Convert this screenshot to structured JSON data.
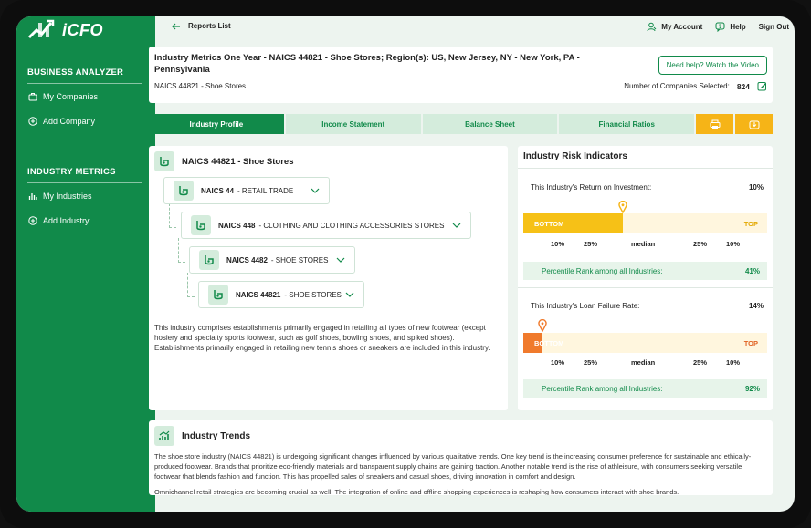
{
  "brand": {
    "name": "iCFO"
  },
  "sidebar": {
    "sections": [
      {
        "title": "BUSINESS ANALYZER",
        "items": [
          {
            "label": "My Companies"
          },
          {
            "label": "Add Company"
          }
        ]
      },
      {
        "title": "INDUSTRY METRICS",
        "items": [
          {
            "label": "My Industries"
          },
          {
            "label": "Add Industry"
          }
        ]
      }
    ]
  },
  "topbar": {
    "back_label": "Reports List",
    "account": "My Account",
    "help": "Help",
    "signout": "Sign Out"
  },
  "header": {
    "title": "Industry Metrics One Year - NAICS 44821 - Shoe Stores; Region(s): US, New Jersey, NY - New York, PA - Pennsylvania",
    "subtitle": "NAICS 44821 - Shoe Stores",
    "help_button": "Need help? Watch the Video",
    "companies_label": "Number of Companies Selected:",
    "companies_count": "824"
  },
  "tabs": [
    "Industry Profile",
    "Income Statement",
    "Balance Sheet",
    "Financial Ratios"
  ],
  "profile": {
    "title": "NAICS 44821 - Shoe Stores",
    "hierarchy": [
      {
        "code": "NAICS 44",
        "name": "- RETAIL TRADE"
      },
      {
        "code": "NAICS 448",
        "name": "- CLOTHING AND CLOTHING ACCESSORIES STORES"
      },
      {
        "code": "NAICS 4482",
        "name": "- SHOE STORES"
      },
      {
        "code": "NAICS 44821",
        "name": "- SHOE STORES"
      }
    ],
    "description": "This industry comprises establishments primarily engaged in retailing all types of new footwear (except hosiery and specialty sports footwear, such as golf shoes, bowling shoes, and spiked shoes). Establishments primarily engaged in retailing new tennis shoes or sneakers are included in this industry."
  },
  "risk": {
    "title": "Industry Risk Indicators",
    "scale_labels": [
      "10%",
      "25%",
      "median",
      "25%",
      "10%"
    ],
    "bar_low": "BOTTOM",
    "bar_high": "TOP",
    "indicators": [
      {
        "label": "This Industry's Return on Investment:",
        "value": "10%",
        "percentile_label": "Percentile Rank among all Industries:",
        "percentile": "41%",
        "fill_fraction": 0.41,
        "fill_color": "#f6c117",
        "high_color": "#e3a800"
      },
      {
        "label": "This Industry's Loan Failure Rate:",
        "value": "14%",
        "percentile_label": "Percentile Rank among all Industries:",
        "percentile": "92%",
        "fill_fraction": 0.08,
        "fill_color": "#f07a2c",
        "high_color": "#e06020"
      }
    ]
  },
  "trends": {
    "title": "Industry Trends",
    "paragraphs": [
      "The shoe store industry (NAICS 44821) is undergoing significant changes influenced by various qualitative trends. One key trend is the increasing consumer preference for sustainable and ethically-produced footwear. Brands that prioritize eco-friendly materials and transparent supply chains are gaining traction. Another notable trend is the rise of athleisure, with consumers seeking versatile footwear that blends fashion and function. This has propelled sales of sneakers and casual shoes, driving innovation in comfort and design.",
      "Omnichannel retail strategies are becoming crucial as well. The integration of online and offline shopping experiences is reshaping how consumers interact with shoe brands."
    ]
  },
  "colors": {
    "primary": "#118a4a",
    "accent": "#f6b417",
    "tab_bg": "#d4ecdc"
  }
}
